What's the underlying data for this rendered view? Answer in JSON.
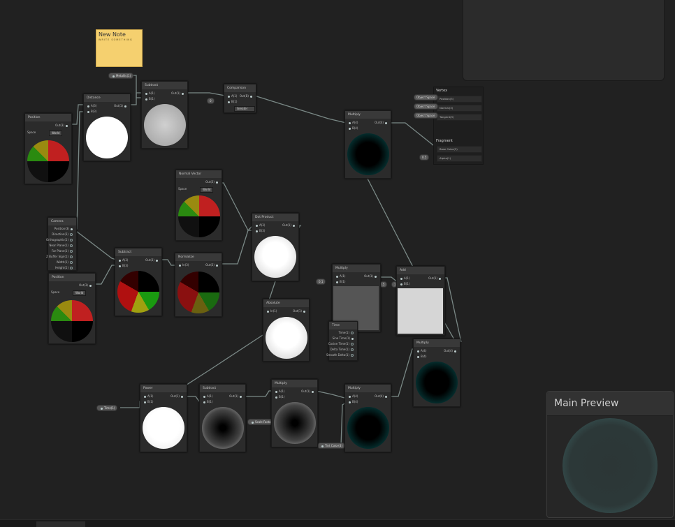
{
  "note": {
    "title": "New Note",
    "body": "WRITE SOMETHING"
  },
  "properties": {
    "metallic": "Metallic(1)",
    "time": "Time(1)",
    "scale_factor": "Scale Factor(1)",
    "tint": "Tint Color(4)",
    "value_a": "0",
    "value_b": "0.1",
    "value_c": "0.5",
    "value_d": "1"
  },
  "nodes": {
    "position_top": {
      "title": "Position",
      "out": "Out(3)",
      "space_label": "Space",
      "space_value": "World"
    },
    "position_bottom": {
      "title": "Position",
      "out": "Out(3)",
      "space_label": "Space",
      "space_value": "World"
    },
    "distance": {
      "title": "Distance",
      "in_a": "A(3)",
      "in_b": "B(3)",
      "out": "Out(1)"
    },
    "subtract_top": {
      "title": "Subtract",
      "in_a": "A(1)",
      "in_b": "B(1)",
      "out": "Out(1)"
    },
    "comparison": {
      "title": "Comparison",
      "in_a": "A(1)",
      "in_b": "B(1)",
      "out": "Out(B)",
      "mode": "Greater"
    },
    "multiply_top": {
      "title": "Multiply",
      "in_a": "A(4)",
      "in_b": "B(4)",
      "out": "Out(4)"
    },
    "camera": {
      "title": "Camera",
      "ports": [
        "Position(3)",
        "Direction(3)",
        "Orthographic(1)",
        "Near Plane(1)",
        "Far Plane(1)",
        "Z Buffer Sign(1)",
        "Width(1)",
        "Height(1)"
      ]
    },
    "subtract_mid": {
      "title": "Subtract",
      "in_a": "A(3)",
      "in_b": "B(3)",
      "out": "Out(3)"
    },
    "normalize": {
      "title": "Normalize",
      "in": "In(3)",
      "out": "Out(3)"
    },
    "normal_vector": {
      "title": "Normal Vector",
      "out": "Out(3)",
      "space_label": "Space",
      "space_value": "World"
    },
    "dot_product": {
      "title": "Dot Product",
      "in_a": "A(3)",
      "in_b": "B(3)",
      "out": "Out(1)"
    },
    "absolute": {
      "title": "Absolute",
      "in": "In(1)",
      "out": "Out(1)"
    },
    "multiply_mid": {
      "title": "Multiply",
      "in_a": "A(1)",
      "in_b": "B(1)",
      "out": "Out(1)"
    },
    "add": {
      "title": "Add",
      "in_a": "A(1)",
      "in_b": "B(1)",
      "out": "Out(1)"
    },
    "time": {
      "title": "Time",
      "ports": [
        "Time(1)",
        "Sine Time(1)",
        "Cosine Time(1)",
        "Delta Time(1)",
        "Smooth Delta(1)"
      ]
    },
    "multiply_right": {
      "title": "Multiply",
      "in_a": "A(4)",
      "in_b": "B(4)",
      "out": "Out(4)"
    },
    "power": {
      "title": "Power",
      "in_a": "A(1)",
      "in_b": "B(1)",
      "out": "Out(1)"
    },
    "subtract_bottom": {
      "title": "Subtract",
      "in_a": "A(1)",
      "in_b": "B(1)",
      "out": "Out(1)"
    },
    "multiply_bottom": {
      "title": "Multiply",
      "in_a": "A(1)",
      "in_b": "B(1)",
      "out": "Out(1)"
    },
    "multiply_bottom2": {
      "title": "Multiply",
      "in_a": "A(4)",
      "in_b": "B(4)",
      "out": "Out(4)"
    }
  },
  "master": {
    "vertex_title": "Vertex",
    "vertex_ports": [
      {
        "pill": "Object Space",
        "label": "Position(3)"
      },
      {
        "pill": "Object Space",
        "label": "Normal(3)"
      },
      {
        "pill": "Object Space",
        "label": "Tangent(3)"
      }
    ],
    "fragment_title": "Fragment",
    "fragment_ports": [
      {
        "pill": "",
        "label": "Base Color(3)"
      },
      {
        "pill": "0.5",
        "label": "Alpha(1)"
      }
    ]
  },
  "main_preview": {
    "title": "Main Preview"
  }
}
